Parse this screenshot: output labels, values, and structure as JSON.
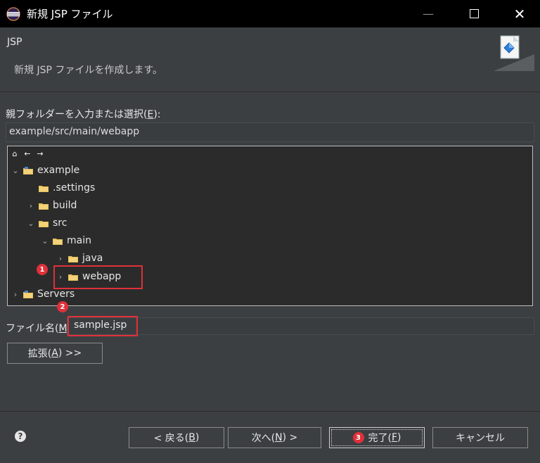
{
  "window": {
    "title": "新規 JSP ファイル"
  },
  "banner": {
    "title": "JSP",
    "description": "新規 JSP ファイルを作成します。"
  },
  "parent_folder": {
    "label_prefix": "親フォルダーを入力または選択(",
    "label_mnemonic": "E",
    "label_suffix": "):",
    "value": "example/src/main/webapp"
  },
  "tree": {
    "items": [
      {
        "label": "example",
        "expanded": true,
        "type": "project"
      },
      {
        "label": ".settings",
        "type": "folder"
      },
      {
        "label": "build",
        "type": "folder"
      },
      {
        "label": "src",
        "type": "folder",
        "expanded": true
      },
      {
        "label": "main",
        "type": "folder",
        "expanded": true
      },
      {
        "label": "java",
        "type": "folder"
      },
      {
        "label": "webapp",
        "type": "folder",
        "selected": true
      },
      {
        "label": "Servers",
        "type": "project"
      }
    ]
  },
  "annotations": {
    "one": "1",
    "two": "2",
    "three": "3"
  },
  "file_name": {
    "label_prefix": "ファイル名(",
    "label_mnemonic": "M",
    "label_suffix": ")",
    "value": "sample.jsp"
  },
  "buttons": {
    "advanced_prefix": "拡張(",
    "advanced_mnemonic": "A",
    "advanced_suffix": ") >>",
    "back_prefix": "< 戻る(",
    "back_mnemonic": "B",
    "back_suffix": ")",
    "next_prefix": "次へ(",
    "next_mnemonic": "N",
    "next_suffix": ") >",
    "finish_prefix": "完了(",
    "finish_mnemonic": "F",
    "finish_suffix": ")",
    "cancel": "キャンセル",
    "help": "?"
  },
  "colors": {
    "accent_red": "#e0303a",
    "folder": "#e8c15a",
    "background": "#3c3f41"
  }
}
